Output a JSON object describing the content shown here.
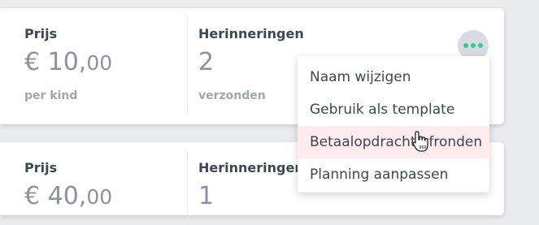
{
  "cards": [
    {
      "price_label": "Prijs",
      "price_main": "€ 10,",
      "price_cents": "00",
      "price_sub": "per kind",
      "reminders_label": "Herinneringen",
      "reminders_value": "2",
      "reminders_sub": "verzonden"
    },
    {
      "price_label": "Prijs",
      "price_main": "€ 40,",
      "price_cents": "00",
      "reminders_label": "Herinneringen",
      "reminders_value": "1"
    }
  ],
  "more_button": {
    "icon": "more-horizontal-icon",
    "dot_color": "#2ccf8f"
  },
  "menu": {
    "items": [
      {
        "label": "Naam wijzigen"
      },
      {
        "label": "Gebruik als template"
      },
      {
        "label": "Betaalopdracht afronden"
      },
      {
        "label": "Planning aanpassen"
      }
    ],
    "hover_color": "#fdebee"
  }
}
